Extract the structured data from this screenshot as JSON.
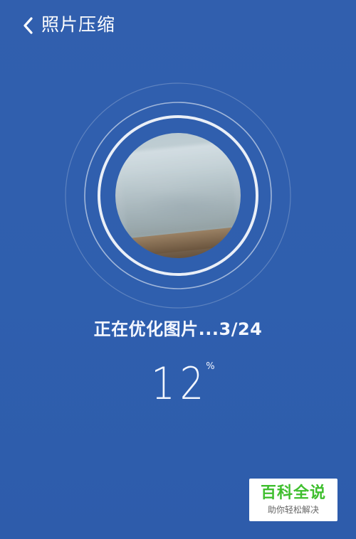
{
  "header": {
    "title": "照片压缩",
    "back_icon": "chevron-left-icon"
  },
  "progress": {
    "status_text": "正在优化图片...3/24",
    "current": 3,
    "total": 24,
    "percent_value": "12",
    "percent_sign": "%"
  },
  "watermark": {
    "title": "百科全说",
    "subtitle": "助你轻松解决"
  },
  "colors": {
    "background": "#2f5fae",
    "ring": "#ffffff",
    "watermark_accent": "#3fbf2e"
  }
}
